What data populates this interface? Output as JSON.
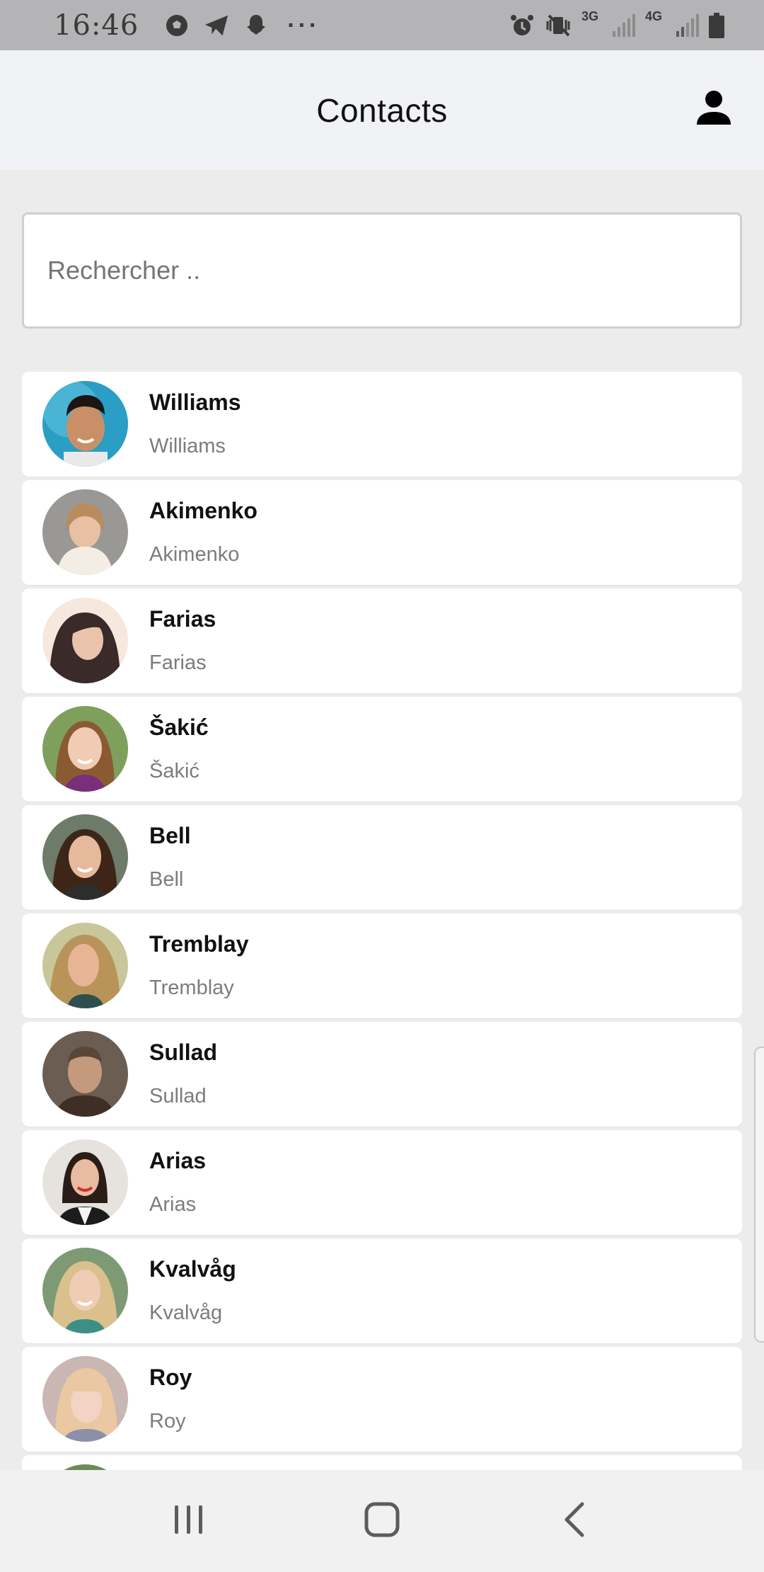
{
  "status_bar": {
    "time": "16:46",
    "left_icons": [
      "soccer-ball-icon",
      "telegram-icon",
      "snapchat-icon"
    ],
    "more": "···",
    "network_3g": "3G",
    "network_4g": "4G"
  },
  "header": {
    "title": "Contacts",
    "profile_icon": "person-icon"
  },
  "search": {
    "placeholder": "Rechercher .."
  },
  "contacts": [
    {
      "name": "Williams",
      "subtitle": "Williams"
    },
    {
      "name": "Akimenko",
      "subtitle": "Akimenko"
    },
    {
      "name": "Farias",
      "subtitle": "Farias"
    },
    {
      "name": "Šakić",
      "subtitle": "Šakić"
    },
    {
      "name": "Bell",
      "subtitle": "Bell"
    },
    {
      "name": "Tremblay",
      "subtitle": "Tremblay"
    },
    {
      "name": "Sullad",
      "subtitle": "Sullad"
    },
    {
      "name": "Arias",
      "subtitle": "Arias"
    },
    {
      "name": "Kvalvåg",
      "subtitle": "Kvalvåg"
    },
    {
      "name": "Roy",
      "subtitle": "Roy"
    }
  ],
  "nav_bar": {
    "recents_icon": "recent-apps-icon",
    "home_icon": "home-icon",
    "back_icon": "back-icon"
  }
}
